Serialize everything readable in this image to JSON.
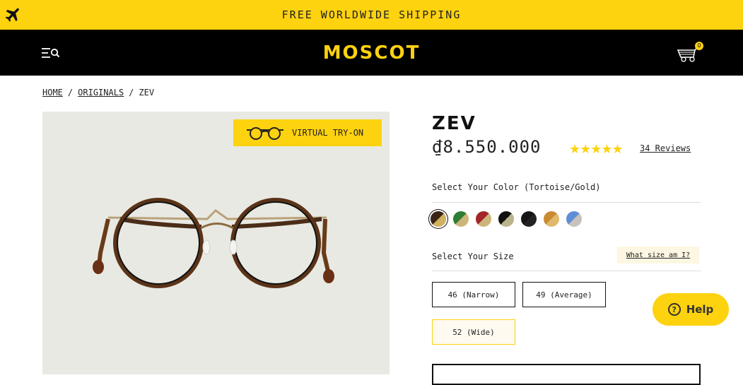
{
  "banner": {
    "text": "FREE WORLDWIDE SHIPPING",
    "icon": "airplane-icon"
  },
  "header": {
    "logo": "MOSCOT",
    "cart_count": "0",
    "menu_icon": "menu-search-icon",
    "cart_icon": "cart-icon"
  },
  "breadcrumb": {
    "items": [
      {
        "label": "HOME"
      },
      {
        "label": "ORIGINALS"
      },
      {
        "label": "ZEV"
      }
    ],
    "separator": "/"
  },
  "image": {
    "vto_label": "VIRTUAL TRY-ON"
  },
  "product": {
    "title": "ZEV",
    "price": "₫8.550.000",
    "rating": 5,
    "stars": "★★★★★",
    "reviews": "34 Reviews"
  },
  "color": {
    "label": "Select Your Color (Tortoise/Gold)",
    "swatches": [
      {
        "name": "Tortoise/Gold",
        "a": "#3a2414",
        "b": "#d2b15e",
        "selected": true
      },
      {
        "name": "Green/Gold",
        "a": "#2e7d32",
        "b": "#cdb57a"
      },
      {
        "name": "Burgundy/Gold",
        "a": "#a3262b",
        "b": "#cdb57a"
      },
      {
        "name": "Black/Gold",
        "a": "#111111",
        "b": "#b9b48a"
      },
      {
        "name": "Black",
        "a": "#151515",
        "b": "#222222"
      },
      {
        "name": "Blonde/Gold",
        "a": "#c98a32",
        "b": "#e0b96c"
      },
      {
        "name": "Blue/Silver",
        "a": "#5f8ed8",
        "b": "#c8c2bb"
      }
    ]
  },
  "size": {
    "label": "Select Your Size",
    "guide": "What size am I?",
    "options": [
      {
        "label": "46 (Narrow)"
      },
      {
        "label": "49 (Average)"
      },
      {
        "label": "52 (Wide)",
        "selected": true
      }
    ]
  },
  "help": {
    "label": "Help",
    "icon": "?"
  },
  "colors": {
    "accent": "#fdd20f",
    "header_bg": "#000000"
  }
}
